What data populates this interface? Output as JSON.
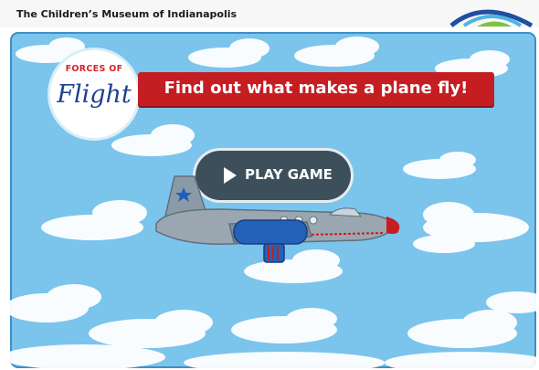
{
  "header": {
    "museum_name": "The Children’s Museum of Indianapolis"
  },
  "game": {
    "logo": {
      "top": "FORCES OF",
      "main": "Flight"
    },
    "tagline": "Find out what makes a plane fly!",
    "play_button_label": "PLAY GAME"
  },
  "icons": [
    "museum-logo-icon",
    "play-icon",
    "airplane-icon",
    "star-icon"
  ],
  "colors": {
    "sky": "#7bc4ec",
    "banner_red": "#c41e23",
    "logo_blue": "#1f3f8f",
    "button_dark": "#3d4f5a"
  }
}
